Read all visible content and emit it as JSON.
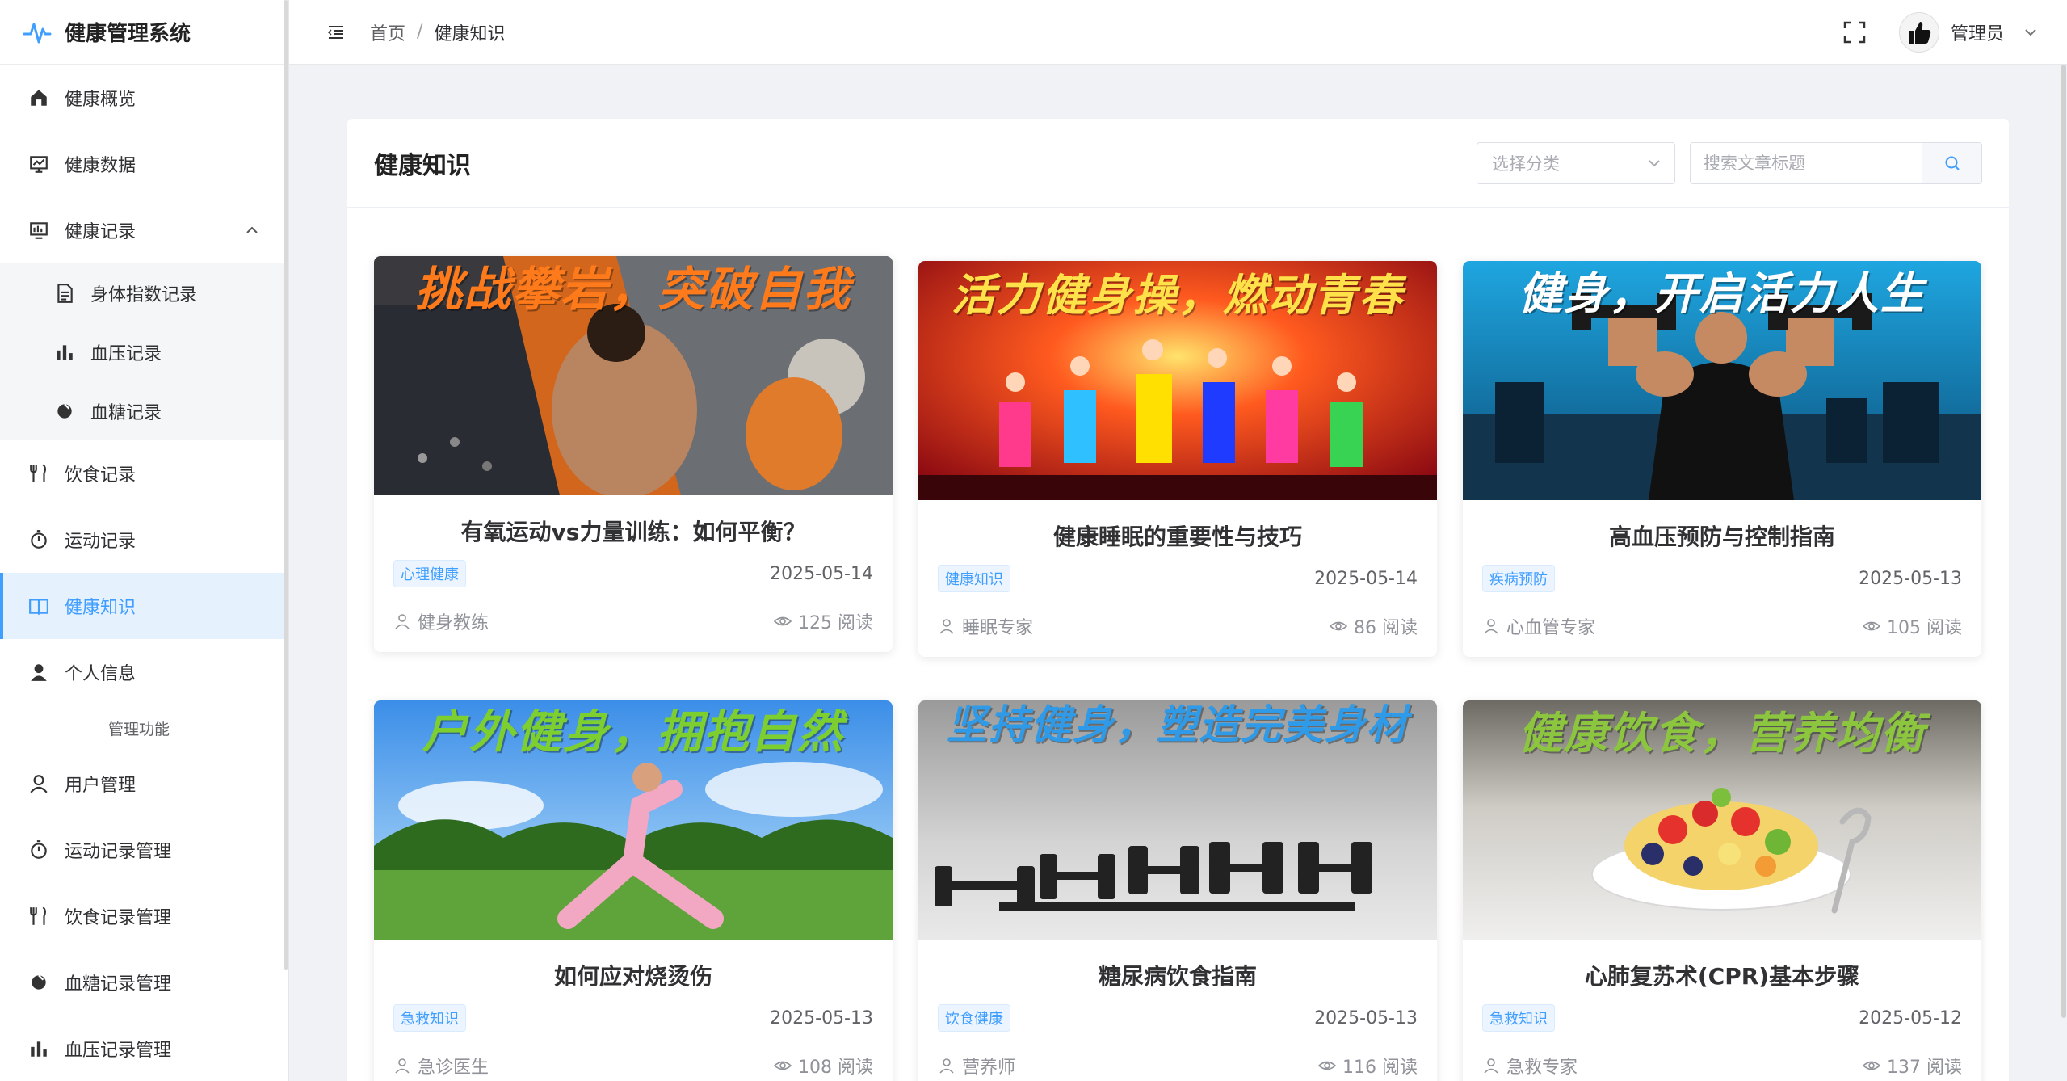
{
  "app": {
    "title": "健康管理系统"
  },
  "sidebar": {
    "items": [
      {
        "label": "健康概览",
        "icon": "home-icon"
      },
      {
        "label": "健康数据",
        "icon": "monitor-chart-icon"
      },
      {
        "label": "健康记录",
        "icon": "record-icon",
        "expanded": true
      },
      {
        "label": "饮食记录",
        "icon": "fork-knife-icon"
      },
      {
        "label": "运动记录",
        "icon": "stopwatch-icon"
      },
      {
        "label": "健康知识",
        "icon": "book-icon",
        "active": true
      },
      {
        "label": "个人信息",
        "icon": "user-icon"
      }
    ],
    "submenu": [
      {
        "label": "身体指数记录",
        "icon": "document-icon"
      },
      {
        "label": "血压记录",
        "icon": "bar-chart-icon"
      },
      {
        "label": "血糖记录",
        "icon": "drop-icon"
      }
    ],
    "group_title": "管理功能",
    "admin_items": [
      {
        "label": "用户管理",
        "icon": "user-outline-icon"
      },
      {
        "label": "运动记录管理",
        "icon": "stopwatch-icon"
      },
      {
        "label": "饮食记录管理",
        "icon": "fork-knife-icon"
      },
      {
        "label": "血糖记录管理",
        "icon": "drop-icon"
      },
      {
        "label": "血压记录管理",
        "icon": "bar-chart-icon"
      }
    ]
  },
  "header": {
    "breadcrumb": [
      "首页",
      "健康知识"
    ],
    "breadcrumb_sep": "/",
    "user_name": "管理员"
  },
  "panel": {
    "title": "健康知识",
    "category_placeholder": "选择分类",
    "search_placeholder": "搜索文章标题"
  },
  "articles": [
    {
      "title": "有氧运动vs力量训练：如何平衡？",
      "tag": "心理健康",
      "date": "2025-05-14",
      "author": "健身教练",
      "views": "125 阅读",
      "image_text": "挑战攀岩，突破自我",
      "image_text_color": "#ff7a1a"
    },
    {
      "title": "健康睡眠的重要性与技巧",
      "tag": "健康知识",
      "date": "2025-05-14",
      "author": "睡眠专家",
      "views": "86 阅读",
      "image_text": "活力健身操，燃动青春",
      "image_text_color": "#ffe14a"
    },
    {
      "title": "高血压预防与控制指南",
      "tag": "疾病预防",
      "date": "2025-05-13",
      "author": "心血管专家",
      "views": "105 阅读",
      "image_text": "健身，开启活力人生",
      "image_text_color": "#ffffff"
    },
    {
      "title": "如何应对烧烫伤",
      "tag": "急救知识",
      "date": "2025-05-13",
      "author": "急诊医生",
      "views": "108 阅读",
      "image_text": "户外健身，拥抱自然",
      "image_text_color": "#7ccf2e"
    },
    {
      "title": "糖尿病饮食指南",
      "tag": "饮食健康",
      "date": "2025-05-13",
      "author": "营养师",
      "views": "116 阅读",
      "image_text": "坚持健身，塑造完美身材",
      "image_text_color": "#2f9be8"
    },
    {
      "title": "心肺复苏术(CPR)基本步骤",
      "tag": "急救知识",
      "date": "2025-05-12",
      "author": "急救专家",
      "views": "137 阅读",
      "image_text": "健康饮食，营养均衡",
      "image_text_color": "#8cc63f"
    }
  ],
  "colors": {
    "accent": "#409eff",
    "active_bg": "#e6f1fe"
  }
}
